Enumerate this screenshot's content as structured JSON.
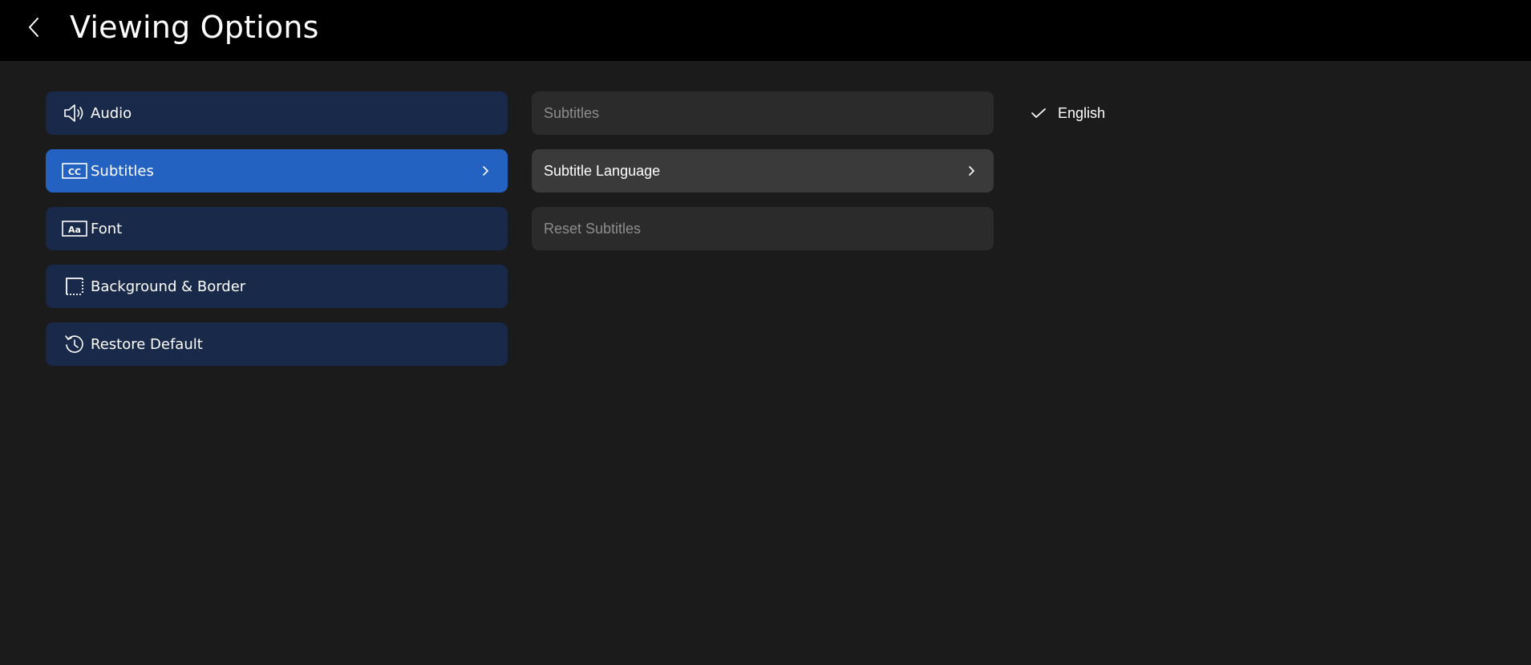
{
  "header": {
    "title": "Viewing Options",
    "back_icon": "chevron-left-icon"
  },
  "left_menu": {
    "items": [
      {
        "label": "Audio",
        "icon": "speaker-icon",
        "active": false
      },
      {
        "label": "Subtitles",
        "icon": "cc-icon",
        "active": true
      },
      {
        "label": "Font",
        "icon": "font-aa-icon",
        "active": false
      },
      {
        "label": "Background & Border",
        "icon": "background-border-icon",
        "active": false
      },
      {
        "label": "Restore Default",
        "icon": "restore-icon",
        "active": false
      }
    ]
  },
  "subtitle_menu": {
    "items": [
      {
        "label": "Subtitles",
        "enabled": false
      },
      {
        "label": "Subtitle Language",
        "enabled": true,
        "highlighted": true
      },
      {
        "label": "Reset Subtitles",
        "enabled": false
      }
    ]
  },
  "language_menu": {
    "items": [
      {
        "label": "English",
        "selected": true
      }
    ]
  },
  "colors": {
    "background": "#1b1b1b",
    "header_background": "#000000",
    "menu_item": "#19294a",
    "menu_item_active": "#2462c2",
    "submenu_item": "#2b2b2b",
    "submenu_item_highlight": "#3a3a3a",
    "disabled_text": "#8d8d8d"
  }
}
